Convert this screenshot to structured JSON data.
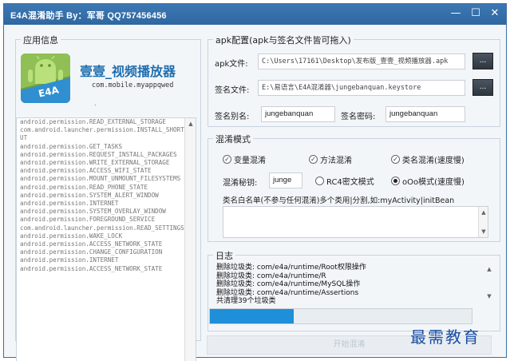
{
  "window": {
    "title": "E4A混淆助手 By：军哥 QQ757456456",
    "minimize": "—",
    "maximize": "☐",
    "close": "✕"
  },
  "app_info": {
    "group_label": "应用信息",
    "icon_text": "E4A",
    "app_name": "壹壹_视频播放器",
    "package": "com.mobile.myappqwed",
    "dot": "."
  },
  "permissions": [
    "android.permission.READ_EXTERNAL_STORAGE",
    "com.android.launcher.permission.INSTALL_SHORTCUT",
    "android.permission.GET_TASKS",
    "android.permission.REQUEST_INSTALL_PACKAGES",
    "android.permission.WRITE_EXTERNAL_STORAGE",
    "android.permission.ACCESS_WIFI_STATE",
    "android.permission.MOUNT_UNMOUNT_FILESYSTEMS",
    "android.permission.READ_PHONE_STATE",
    "android.permission.SYSTEM_ALERT_WINDOW",
    "android.permission.INTERNET",
    "android.permission.SYSTEM_OVERLAY_WINDOW",
    "android.permission.FOREGROUND_SERVICE",
    "com.android.launcher.permission.READ_SETTINGS",
    "android.permission.WAKE_LOCK",
    "android.permission.ACCESS_NETWORK_STATE",
    "android.permission.CHANGE_CONFIGURATION",
    "android.permission.INTERNET",
    "android.permission.ACCESS_NETWORK_STATE"
  ],
  "apk_config": {
    "group_label": "apk配置(apk与签名文件皆可拖入)",
    "apk_label": "apk文件:",
    "apk_value": "C:\\Users\\17161\\Desktop\\发布版_壹壹_视频播放器.apk",
    "sign_label": "签名文件:",
    "sign_value": "E:\\易语言\\E4A混淆器\\jungebanquan.keystore",
    "browse_label": "...",
    "alias_label": "签名别名:",
    "alias_value": "jungebanquan",
    "password_label": "签名密码:",
    "password_value": "jungebanquan"
  },
  "obfuscate": {
    "group_label": "混淆模式",
    "opt_var": "变量混淆",
    "opt_method": "方法混淆",
    "opt_class": "类名混淆(速度慢)",
    "key_label": "混淆秘钥:",
    "key_value": "junge",
    "rc4_label": "RC4密文模式",
    "ooo_label": "oOo模式(速度慢)",
    "whitelist_hint": "类名白名单(不参与任何混淆)多个类用|分割,如:myActivity|initBean"
  },
  "log": {
    "group_label": "日志",
    "lines": [
      "删除垃圾类: com/e4a/runtime/Root权限操作",
      "删除垃圾类: com/e4a/runtime/R",
      "删除垃圾类: com/e4a/runtime/MySQL操作",
      "删除垃圾类: com/e4a/runtime/Assertions",
      "共清理39个垃圾类"
    ]
  },
  "progress": {
    "value": 0.32
  },
  "start_button": "开始混淆",
  "watermark": "最需教育"
}
